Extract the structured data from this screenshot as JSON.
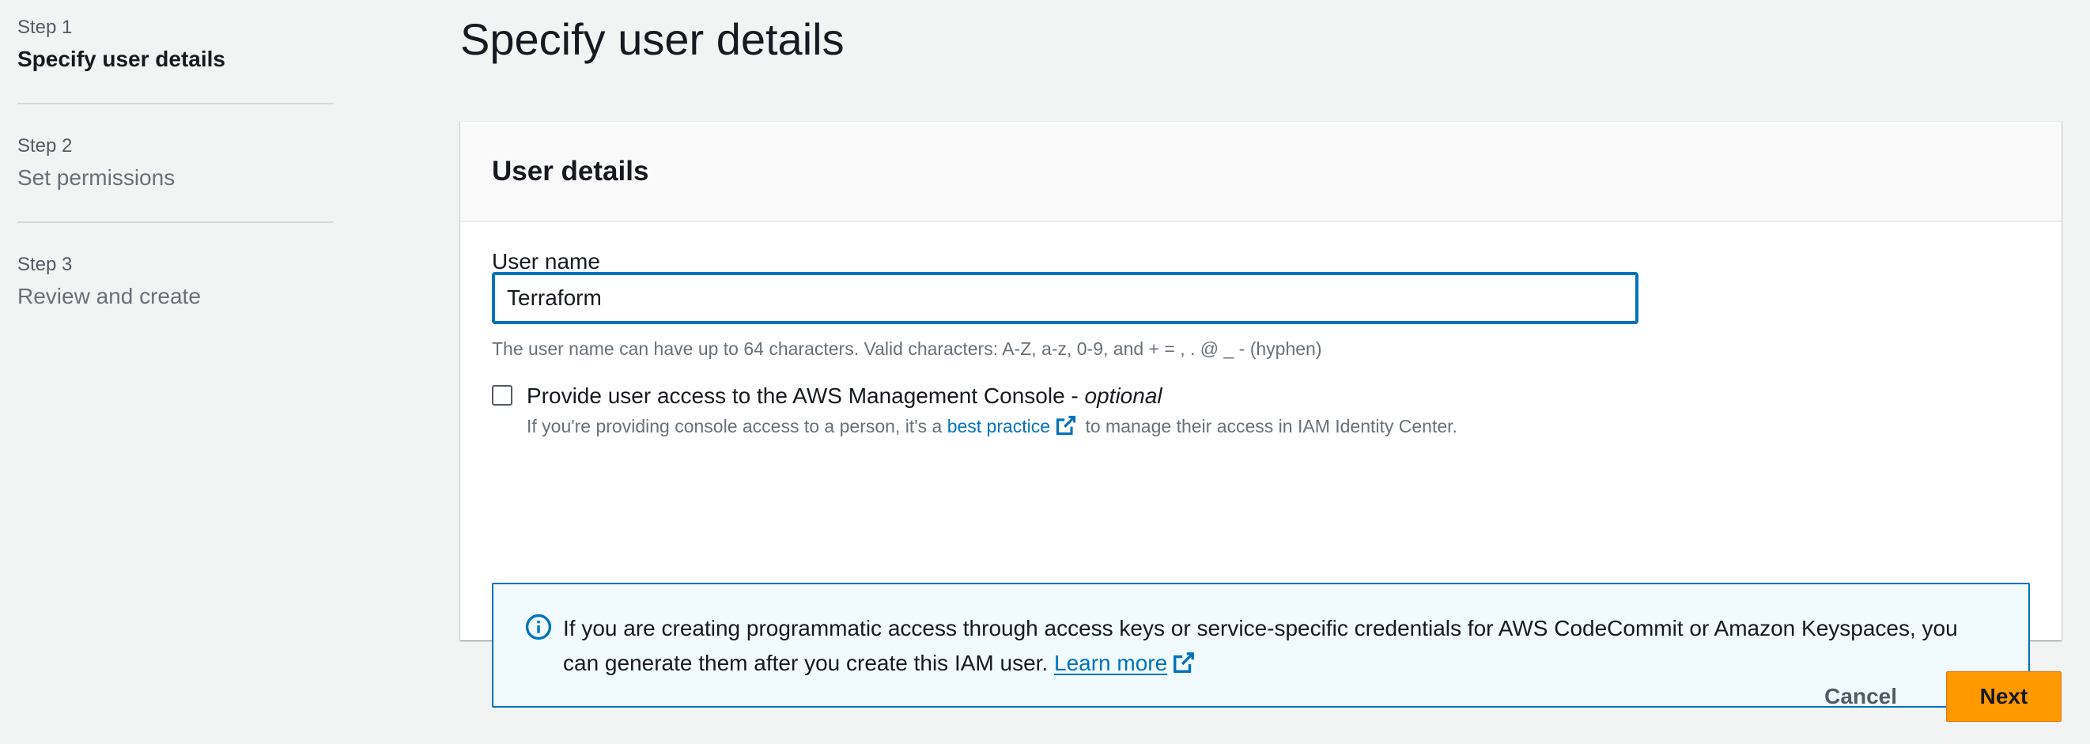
{
  "steps": [
    {
      "number": "Step 1",
      "title": "Specify user details",
      "active": true
    },
    {
      "number": "Step 2",
      "title": "Set permissions",
      "active": false
    },
    {
      "number": "Step 3",
      "title": "Review and create",
      "active": false
    }
  ],
  "page": {
    "title": "Specify user details"
  },
  "user_details": {
    "heading": "User details",
    "username_label": "User name",
    "username_value": "Terraform",
    "username_constraint": "The user name can have up to 64 characters. Valid characters: A-Z, a-z, 0-9, and + = , . @ _ - (hyphen)",
    "console_access": {
      "label": "Provide user access to the AWS Management Console - ",
      "optional": "optional",
      "checked": false,
      "desc_before": "If you're providing console access to a person, it's a ",
      "link": "best practice",
      "desc_after": " to manage their access in IAM Identity Center."
    },
    "info_alert": {
      "text": "If you are creating programmatic access through access keys or service-specific credentials for AWS CodeCommit or Amazon Keyspaces, you can generate them after you create this IAM user. ",
      "link": "Learn more"
    }
  },
  "actions": {
    "cancel": "Cancel",
    "next": "Next"
  },
  "colors": {
    "background": "#f2f3f3",
    "link": "#0073bb",
    "primary_button": "#ff9900",
    "alert_background": "#f1faff"
  },
  "icons": {
    "external_link": "external-link-icon",
    "info": "info-icon"
  }
}
